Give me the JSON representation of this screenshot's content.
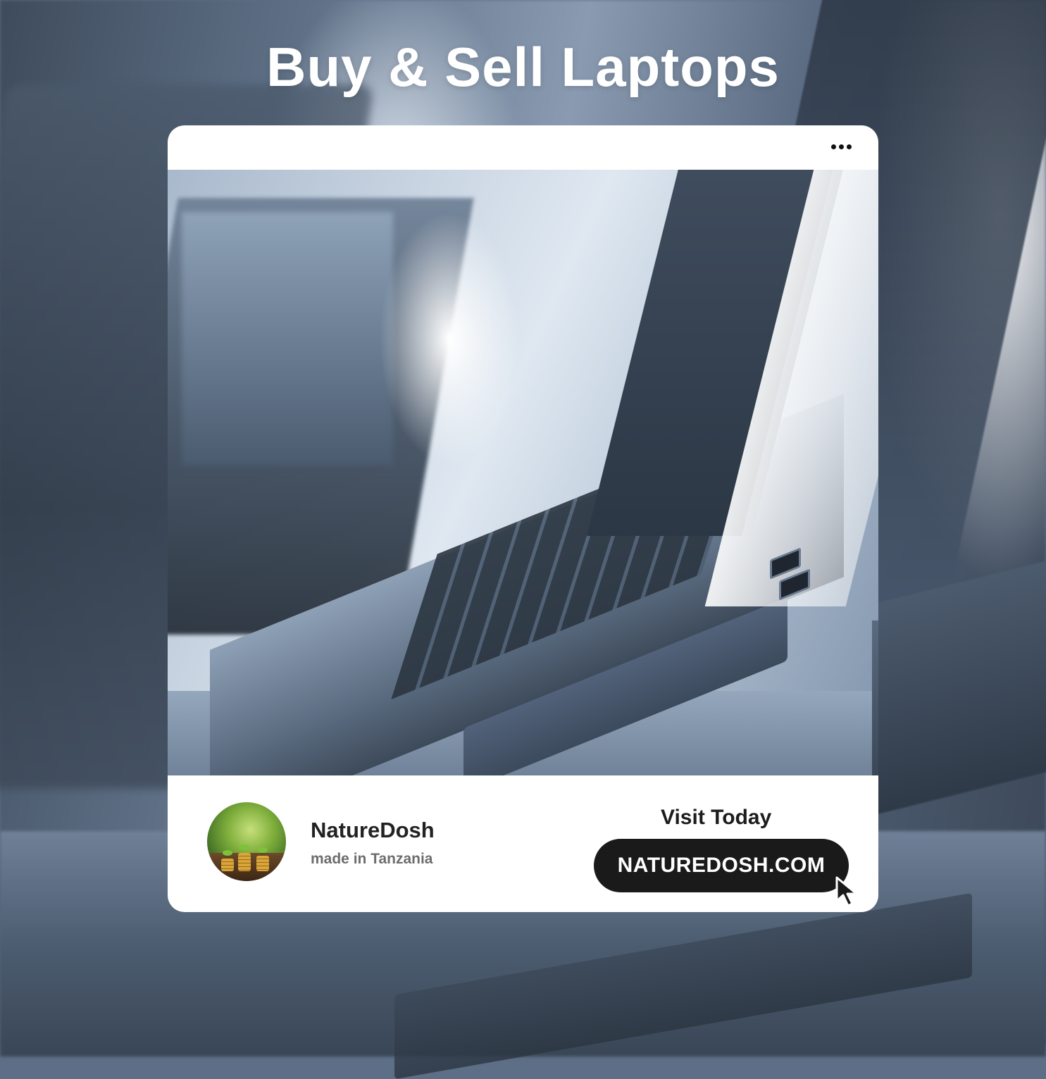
{
  "headline": "Buy & Sell Laptops",
  "card": {
    "menu_icon": "more-horizontal-icon",
    "photo_icon": "laptops-photo",
    "brand": {
      "name": "NatureDosh",
      "subtitle": "made in Tanzania",
      "avatar_icon": "sprouts-on-coins-logo"
    },
    "cta": {
      "label": "Visit Today",
      "button": "NATUREDOSH.COM",
      "cursor_icon": "mouse-pointer-icon"
    }
  },
  "colors": {
    "card_bg": "#ffffff",
    "button_bg": "#1a1a1a",
    "headline_color": "#ffffff"
  }
}
